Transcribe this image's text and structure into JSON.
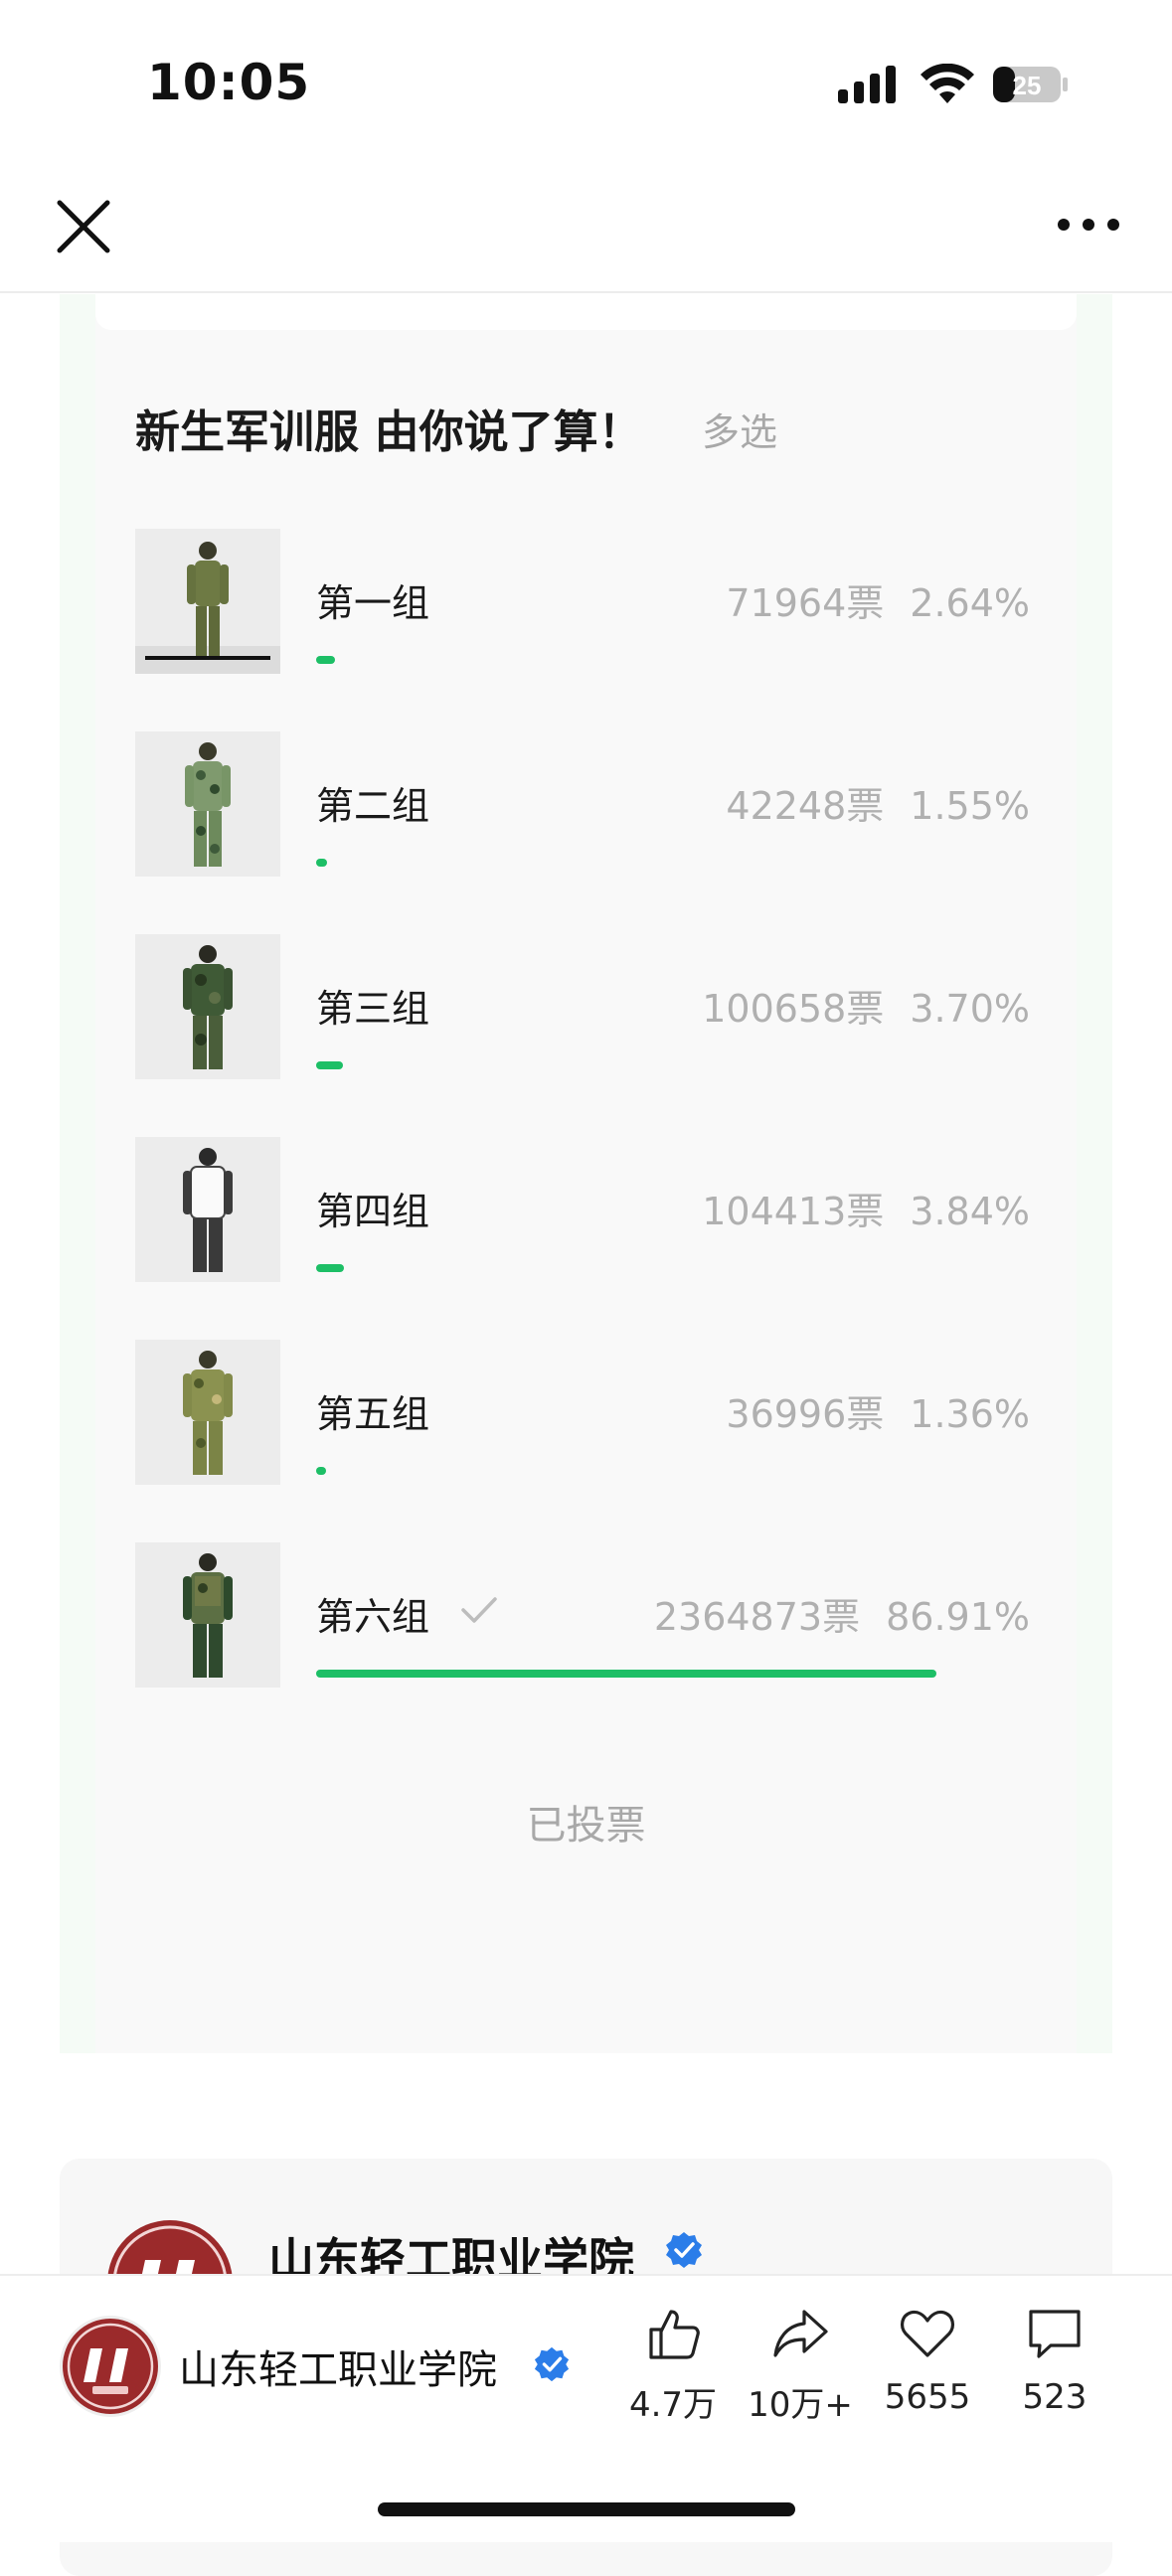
{
  "status_bar": {
    "time": "10:05",
    "battery": "25"
  },
  "poll": {
    "title": "新生军训服 由你说了算！",
    "type": "多选",
    "options": [
      {
        "label": "第一组",
        "votes": "71964票",
        "percent": "2.64%",
        "fraction": 0.0264,
        "selected": false
      },
      {
        "label": "第二组",
        "votes": "42248票",
        "percent": "1.55%",
        "fraction": 0.0155,
        "selected": false
      },
      {
        "label": "第三组",
        "votes": "100658票",
        "percent": "3.70%",
        "fraction": 0.037,
        "selected": false
      },
      {
        "label": "第四组",
        "votes": "104413票",
        "percent": "3.84%",
        "fraction": 0.0384,
        "selected": false
      },
      {
        "label": "第五组",
        "votes": "36996票",
        "percent": "1.36%",
        "fraction": 0.0136,
        "selected": false
      },
      {
        "label": "第六组",
        "votes": "2364873票",
        "percent": "86.91%",
        "fraction": 0.8691,
        "selected": true
      }
    ],
    "voted_label": "已投票"
  },
  "profile": {
    "name": "山东轻工职业学院",
    "verified": true
  },
  "bottom_bar": {
    "name": "山东轻工职业学院",
    "actions": [
      {
        "icon": "thumbs-up-icon",
        "count": "4.7万"
      },
      {
        "icon": "share-icon",
        "count": "10万+"
      },
      {
        "icon": "heart-icon",
        "count": "5655"
      },
      {
        "icon": "comment-icon",
        "count": "523"
      }
    ]
  },
  "colors": {
    "accent": "#1dbf66",
    "muted": "#a8a8a8",
    "verified": "#2b7de9",
    "logo": "#9b2a2b"
  }
}
